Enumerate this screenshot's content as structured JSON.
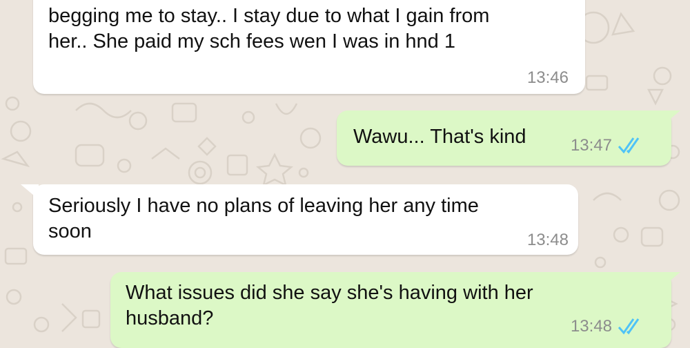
{
  "chat": {
    "messages": [
      {
        "direction": "incoming",
        "text_line1": "begging me to stay..  I stay due to what I gain from",
        "text_line2": "her.. She paid my sch fees wen I was in hnd 1",
        "time": "13:46"
      },
      {
        "direction": "outgoing",
        "text": "Wawu... That's kind",
        "time": "13:47",
        "status": "read"
      },
      {
        "direction": "incoming",
        "text_line1": "Seriously I have no plans of leaving her any time",
        "text_line2": "soon",
        "time": "13:48"
      },
      {
        "direction": "outgoing",
        "text_line1": "What issues did she say she's having with her",
        "text_line2": "husband?",
        "time": "13:48",
        "status": "read"
      }
    ]
  },
  "colors": {
    "wallpaper": "#ece5dd",
    "incoming_bubble": "#ffffff",
    "outgoing_bubble": "#dcf8c6",
    "read_ticks": "#4fc3f7",
    "timestamp": "#8c8c8c"
  },
  "icons": [
    "double-check-icon"
  ]
}
